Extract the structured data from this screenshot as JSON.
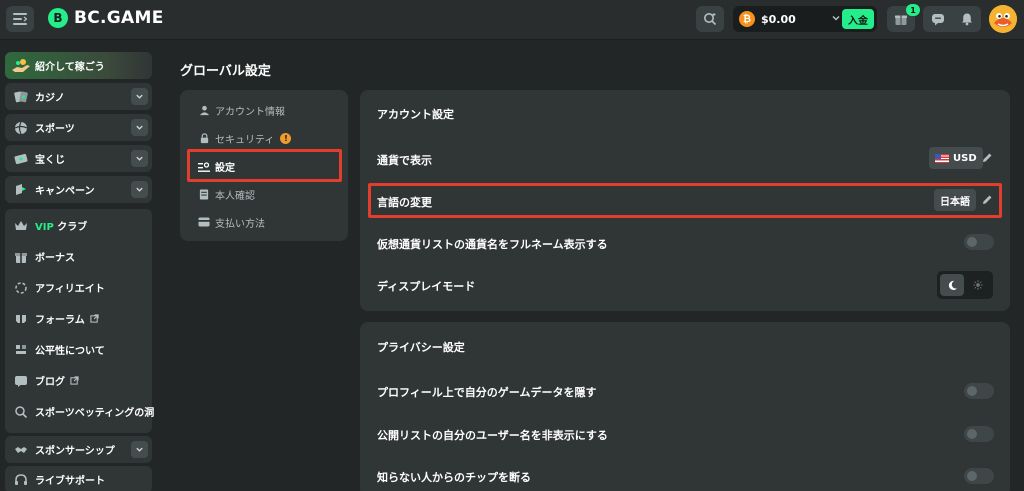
{
  "header": {
    "logo_text": "BC.GAME",
    "balance": "$0.00",
    "deposit_label": "入金",
    "gift_badge": "1"
  },
  "sidebar": {
    "invite_label": "紹介して稼ごう",
    "items": [
      {
        "label": "カジノ",
        "icon": "casino-icon"
      },
      {
        "label": "スポーツ",
        "icon": "sports-icon"
      },
      {
        "label": "宝くじ",
        "icon": "lottery-icon"
      },
      {
        "label": "キャンペーン",
        "icon": "campaign-icon"
      }
    ],
    "group": {
      "vip_prefix": "VIP",
      "vip_label": "クラブ",
      "items": [
        {
          "label": "ボーナス",
          "icon": "bonus-icon"
        },
        {
          "label": "アフィリエイト",
          "icon": "affiliate-icon"
        },
        {
          "label": "フォーラム",
          "icon": "forum-icon"
        },
        {
          "label": "公平性について",
          "icon": "fairness-icon"
        },
        {
          "label": "ブログ",
          "icon": "blog-icon"
        },
        {
          "label": "スポーツベッティングの洞",
          "icon": "sports-betting-icon"
        }
      ]
    },
    "sponsorship_label": "スポンサーシップ",
    "support_label": "ライブサポート"
  },
  "page": {
    "title": "グローバル設定"
  },
  "settings_nav": [
    {
      "label": "アカウント情報",
      "icon": "user-icon"
    },
    {
      "label": "セキュリティ",
      "icon": "lock-icon"
    },
    {
      "label": "設定",
      "icon": "settings-icon"
    },
    {
      "label": "本人確認",
      "icon": "id-icon"
    },
    {
      "label": "支払い方法",
      "icon": "card-icon"
    }
  ],
  "account_settings": {
    "title": "アカウント設定",
    "currency_label": "通貨で表示",
    "currency_value": "USD",
    "language_label": "言語の変更",
    "language_value": "日本語",
    "fullname_label": "仮想通貨リストの通貨名をフルネーム表示する",
    "fullname_on": false,
    "display_mode_label": "ディスプレイモード",
    "display_mode": "dark"
  },
  "privacy_settings": {
    "title": "プライバシー設定",
    "items": [
      {
        "label": "プロフィール上で自分のゲームデータを隠す",
        "on": false
      },
      {
        "label": "公開リストの自分のユーザー名を非表示にする",
        "on": false
      },
      {
        "label": "知らない人からのチップを断る",
        "on": false
      }
    ]
  },
  "colors": {
    "accent": "#24ee89",
    "highlight": "#e23e2d",
    "warning": "#ee9b2f"
  }
}
